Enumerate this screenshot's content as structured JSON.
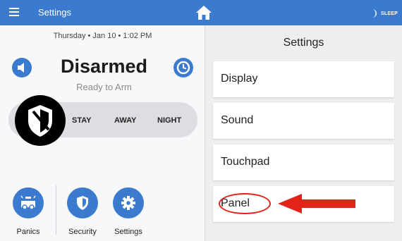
{
  "topbar": {
    "title": "Settings",
    "sleep_label": "SLEEP",
    "bg_color": "#3a7bd0"
  },
  "status": {
    "datetime": "Thursday  •  Jan 10  •  1:02 PM",
    "title": "Disarmed",
    "subtitle": "Ready to Arm"
  },
  "arm_options": [
    "STAY",
    "AWAY",
    "NIGHT"
  ],
  "quick_actions": {
    "panics": "Panics",
    "security": "Security",
    "settings": "Settings"
  },
  "settings_menu": {
    "title": "Settings",
    "items": [
      "Display",
      "Sound",
      "Touchpad",
      "Panel"
    ],
    "highlighted_item": "Panel",
    "annotation_color": "#e2231a"
  }
}
